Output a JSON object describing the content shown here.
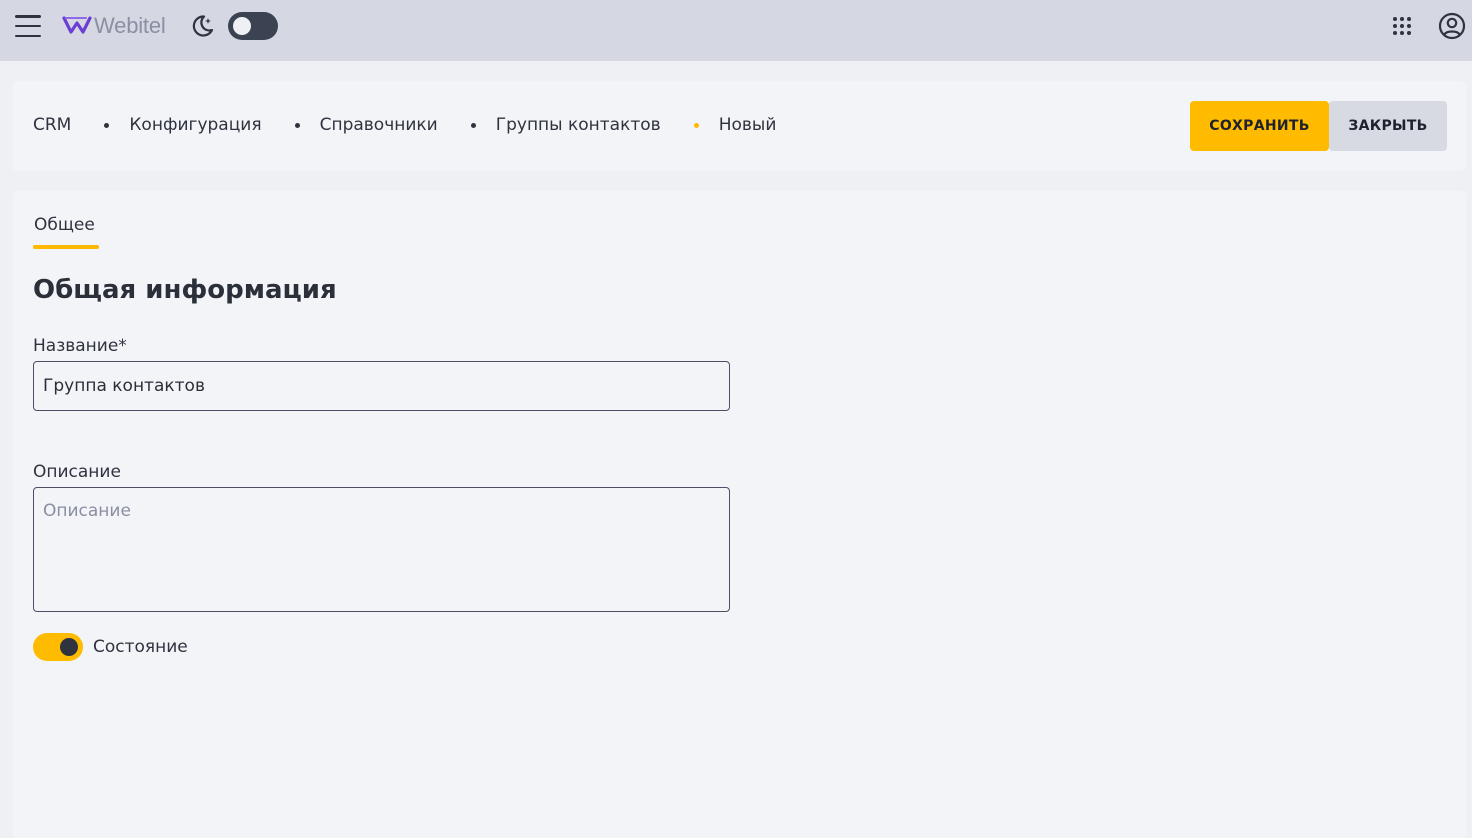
{
  "topbar": {
    "logo_text": "Webitel",
    "icons": {
      "menu": "hamburger-menu-icon",
      "theme": "moon-sparkle-icon",
      "apps": "apps-grid-icon",
      "account": "account-circle-icon"
    },
    "dark_mode_enabled": false
  },
  "breadcrumb": {
    "items": [
      "CRM",
      "Конфигурация",
      "Справочники",
      "Группы контактов",
      "Новый"
    ]
  },
  "actions": {
    "save_label": "СОХРАНИТЬ",
    "close_label": "ЗАКРЫТЬ"
  },
  "tabs": [
    {
      "label": "Общее",
      "active": true
    }
  ],
  "form": {
    "section_title": "Общая информация",
    "name": {
      "label": "Название*",
      "value": "Группа контактов"
    },
    "description": {
      "label": "Описание",
      "value": "",
      "placeholder": "Описание"
    },
    "state": {
      "label": "Состояние",
      "enabled": true
    }
  },
  "colors": {
    "accent": "#ffbb00",
    "topbar_bg": "#d5d8e2",
    "surface": "#f3f4f7",
    "page_bg": "#eef0f4",
    "text": "#2b2f3a"
  }
}
